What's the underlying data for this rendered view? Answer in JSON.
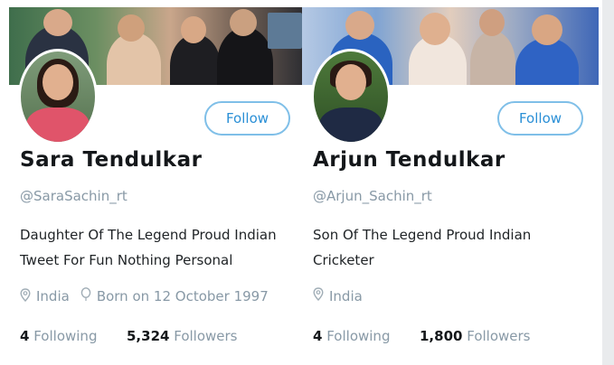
{
  "profiles": [
    {
      "name": "Sara Tendulkar",
      "handle": "@SaraSachin_rt",
      "follow_label": "Follow",
      "bio_line1": "Daughter Of The Legend Proud Indian",
      "bio_line2": "Tweet For Fun Nothing Personal",
      "location": "India",
      "born": "Born on 12 October 1997",
      "following_count": "4",
      "following_label": "Following",
      "followers_count": "5,324",
      "followers_label": "Followers"
    },
    {
      "name": "Arjun Tendulkar",
      "handle": "@Arjun_Sachin_rt",
      "follow_label": "Follow",
      "bio_line1": "Son Of The Legend Proud Indian",
      "bio_line2": "Cricketer",
      "location": "India",
      "following_count": "4",
      "following_label": "Following",
      "followers_count": "1,800",
      "followers_label": "Followers"
    }
  ],
  "icons": {
    "location": "location-pin-icon",
    "birthday": "balloon-icon"
  },
  "colors": {
    "accent": "#2a8fd6",
    "button_border": "#7fbfe8",
    "muted_text": "#8899a6"
  }
}
